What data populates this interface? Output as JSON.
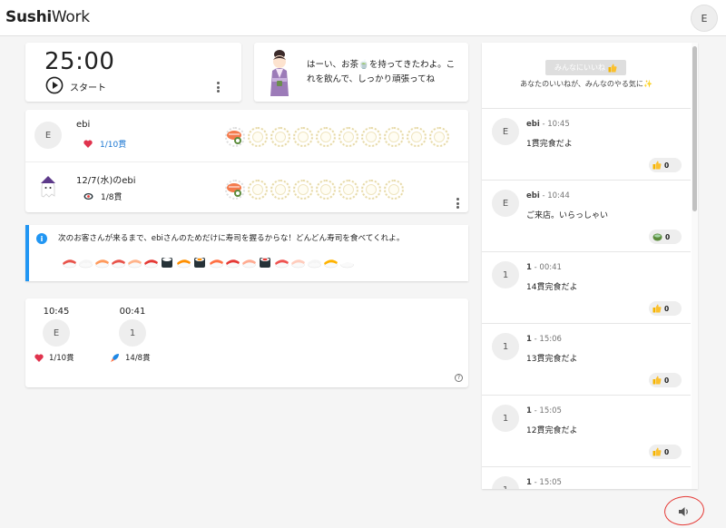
{
  "app": {
    "logo_bold": "Sushi",
    "logo_light": "Work",
    "user_initial": "E"
  },
  "timer": {
    "time": "25:00",
    "start_label": "スタート"
  },
  "okami_message": "はーい、お茶🍵を持ってきたわよ。これを飲んで、しっかり頑張ってね",
  "members": [
    {
      "initial": "E",
      "name": "ebi",
      "count": "1/10貫",
      "icon": "heart-icon",
      "plates_full": 1,
      "plates_total": 10
    },
    {
      "initial": "",
      "name": "12/7(水)のebi",
      "count": "1/8貫",
      "icon": "sushi-icon",
      "plates_full": 1,
      "plates_total": 8
    }
  ],
  "info": {
    "text": "次のお客さんが来るまで、ebiさんのためだけに寿司を握るからな！どんどん寿司を食べてくれよ。",
    "sushi_count": 18
  },
  "history": [
    {
      "time": "10:45",
      "initial": "E",
      "icon": "heart-icon",
      "count": "1/10貫"
    },
    {
      "time": "00:41",
      "initial": "1",
      "icon": "rocket-icon",
      "count": "14/8貫"
    }
  ],
  "right_panel": {
    "like_button": "みんなにいいね",
    "like_note": "あなたのいいねが、みんなのやる気に",
    "feed": [
      {
        "initial": "E",
        "name": "ebi",
        "time": "10:45",
        "text": "1貫完食だよ",
        "reaction": "thumbs-up-icon",
        "count": "0"
      },
      {
        "initial": "E",
        "name": "ebi",
        "time": "10:44",
        "text": "ご来店。いらっしゃい",
        "reaction": "tea-icon",
        "count": "0"
      },
      {
        "initial": "1",
        "name": "1",
        "time": "00:41",
        "text": "14貫完食だよ",
        "reaction": "thumbs-up-icon",
        "count": "0"
      },
      {
        "initial": "1",
        "name": "1",
        "time": "15:06",
        "text": "13貫完食だよ",
        "reaction": "thumbs-up-icon",
        "count": "0"
      },
      {
        "initial": "1",
        "name": "1",
        "time": "15:05",
        "text": "12貫完食だよ",
        "reaction": "thumbs-up-icon",
        "count": "0"
      },
      {
        "initial": "1",
        "name": "1",
        "time": "15:05",
        "text": "",
        "reaction": "",
        "count": ""
      }
    ]
  },
  "colors": {
    "accent_blue": "#2196f3",
    "count_blue": "#1976d2",
    "annotation_red": "#e53935"
  }
}
